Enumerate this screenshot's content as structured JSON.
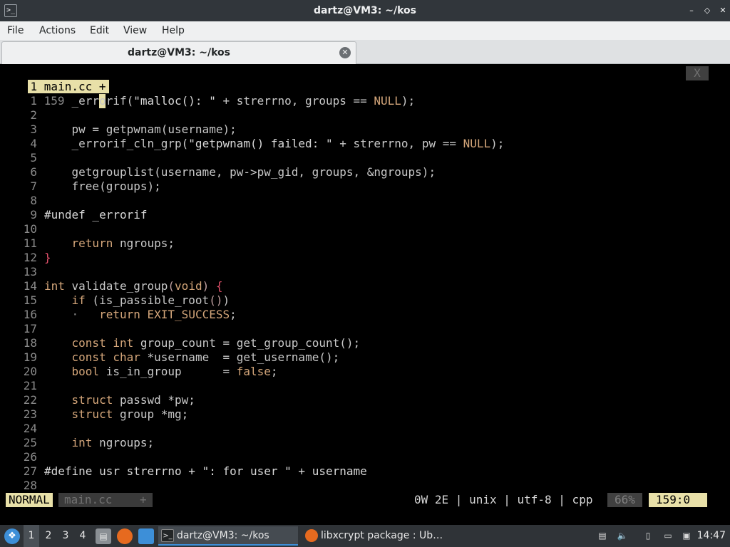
{
  "window": {
    "title": "dartz@VM3: ~/kos",
    "app_icon": ">_",
    "minimize_glyph": "–",
    "maximize_glyph": "◇",
    "close_glyph": "✕"
  },
  "menubar": {
    "items": [
      "File",
      "Actions",
      "Edit",
      "View",
      "Help"
    ]
  },
  "tabbar": {
    "tab_title": "dartz@VM3: ~/kos",
    "close_glyph": "✕"
  },
  "vim": {
    "buffer_tab": "1 main.cc +",
    "buffer_close": "X",
    "current_line_number": "159",
    "lines": [
      {
        "n": "1",
        "segs": [
          [
            "    _errorif(",
            ""
          ],
          [
            "\"malloc(): \"",
            "str"
          ],
          [
            " + strerrno, groups == ",
            ""
          ],
          [
            "NULL",
            "const"
          ],
          [
            ");",
            ""
          ]
        ]
      },
      {
        "n": "2",
        "segs": []
      },
      {
        "n": "3",
        "segs": [
          [
            "    pw = getpwnam(username);",
            ""
          ]
        ]
      },
      {
        "n": "4",
        "segs": [
          [
            "    _errorif_cln_grp(",
            ""
          ],
          [
            "\"getpwnam() failed: \"",
            "str"
          ],
          [
            " + strerrno, pw == ",
            ""
          ],
          [
            "NULL",
            "const"
          ],
          [
            ");",
            ""
          ]
        ]
      },
      {
        "n": "5",
        "segs": []
      },
      {
        "n": "6",
        "segs": [
          [
            "    getgrouplist(username, pw->pw_gid, groups, &ngroups);",
            ""
          ]
        ]
      },
      {
        "n": "7",
        "segs": [
          [
            "    free(groups);",
            ""
          ]
        ]
      },
      {
        "n": "8",
        "segs": []
      },
      {
        "n": "9",
        "segs": [
          [
            "#undef _errorif",
            "pre"
          ]
        ]
      },
      {
        "n": "10",
        "segs": []
      },
      {
        "n": "11",
        "segs": [
          [
            "    ",
            ""
          ],
          [
            "return",
            "kw"
          ],
          [
            " ngroups;",
            ""
          ]
        ]
      },
      {
        "n": "12",
        "segs": [
          [
            "}",
            "red"
          ]
        ]
      },
      {
        "n": "13",
        "segs": []
      },
      {
        "n": "14",
        "segs": [
          [
            "int",
            "type"
          ],
          [
            " validate_group",
            ""
          ],
          [
            "(",
            "paren"
          ],
          [
            "void",
            "type"
          ],
          [
            ")",
            "paren"
          ],
          [
            " ",
            ""
          ],
          [
            "{",
            "red"
          ]
        ]
      },
      {
        "n": "15",
        "segs": [
          [
            "    ",
            ""
          ],
          [
            "if",
            "kw"
          ],
          [
            " (is_passible_root",
            ""
          ],
          [
            "()",
            "paren"
          ],
          [
            ")",
            ""
          ]
        ]
      },
      {
        "n": "16",
        "segs": [
          [
            "    ",
            ""
          ],
          [
            "·",
            "dim"
          ],
          [
            "   ",
            ""
          ],
          [
            "return",
            "kw"
          ],
          [
            " ",
            ""
          ],
          [
            "EXIT_SUCCESS",
            "const"
          ],
          [
            ";",
            ""
          ]
        ]
      },
      {
        "n": "17",
        "segs": []
      },
      {
        "n": "18",
        "segs": [
          [
            "    ",
            ""
          ],
          [
            "const",
            "kw"
          ],
          [
            " ",
            ""
          ],
          [
            "int",
            "type"
          ],
          [
            " group_count = get_group_count();",
            ""
          ]
        ]
      },
      {
        "n": "19",
        "segs": [
          [
            "    ",
            ""
          ],
          [
            "const",
            "kw"
          ],
          [
            " ",
            ""
          ],
          [
            "char",
            "type"
          ],
          [
            " *username  = get_username();",
            ""
          ]
        ]
      },
      {
        "n": "20",
        "segs": [
          [
            "    ",
            ""
          ],
          [
            "bool",
            "type"
          ],
          [
            " is_in_group      = ",
            ""
          ],
          [
            "false",
            "const"
          ],
          [
            ";",
            ""
          ]
        ]
      },
      {
        "n": "21",
        "segs": []
      },
      {
        "n": "22",
        "segs": [
          [
            "    ",
            ""
          ],
          [
            "struct",
            "kw"
          ],
          [
            " passwd *pw;",
            ""
          ]
        ]
      },
      {
        "n": "23",
        "segs": [
          [
            "    ",
            ""
          ],
          [
            "struct",
            "kw"
          ],
          [
            " group *mg;",
            ""
          ]
        ]
      },
      {
        "n": "24",
        "segs": []
      },
      {
        "n": "25",
        "segs": [
          [
            "    ",
            ""
          ],
          [
            "int",
            "type"
          ],
          [
            " ngroups;",
            ""
          ]
        ]
      },
      {
        "n": "26",
        "segs": []
      },
      {
        "n": "27",
        "segs": [
          [
            "#define usr strerrno + ",
            "pre"
          ],
          [
            "\": for user \"",
            "str"
          ],
          [
            " + username",
            "pre"
          ]
        ]
      },
      {
        "n": "28",
        "segs": []
      }
    ],
    "status": {
      "mode": "NORMAL",
      "filename": "main.cc",
      "modified": "+",
      "info": "0W 2E | unix | utf-8 | cpp",
      "percent": "66%",
      "position": "159:0"
    }
  },
  "taskbar": {
    "start_icon": "menu-icon",
    "workspaces": [
      "1",
      "2",
      "3",
      "4"
    ],
    "tasks": [
      {
        "label": "dartz@VM3: ~/kos",
        "icon": "terminal-icon"
      },
      {
        "label": "libxcrypt package : Ub…",
        "icon": "firefox-icon"
      }
    ],
    "clock": "14:47"
  },
  "colors": {
    "accent": "#3d8fd8",
    "statusline_yellow": "#e8e0a8",
    "error_red": "#e0506a"
  }
}
